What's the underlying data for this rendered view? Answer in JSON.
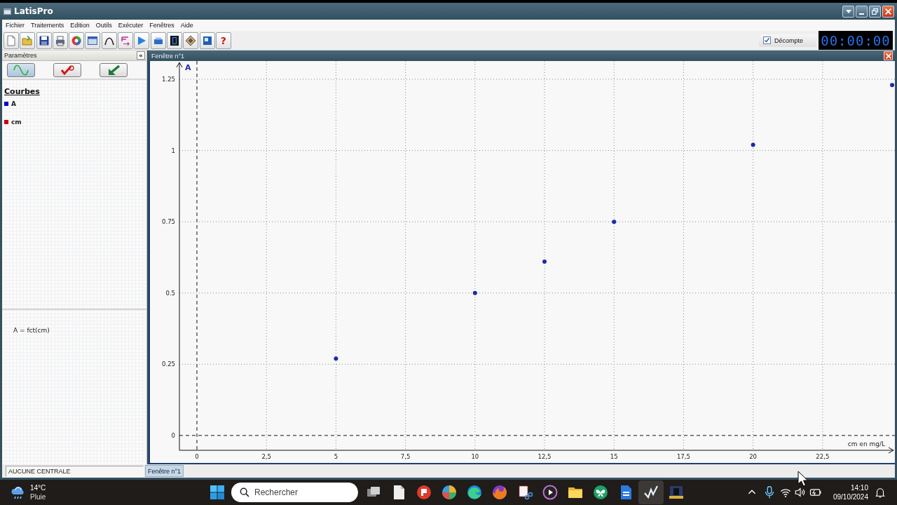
{
  "window": {
    "title": "LatisPro"
  },
  "menu": [
    "Fichier",
    "Traitements",
    "Edition",
    "Outils",
    "Exécuter",
    "Fenêtres",
    "Aide"
  ],
  "toolbar": {
    "help_label": "?",
    "countdown": {
      "label": "Décompte",
      "checked": true
    },
    "timer": "00:00:00"
  },
  "parameters_panel": {
    "title": "Paramètres",
    "collapse_label": "«",
    "mode_buttons": [
      {
        "selected": true
      },
      {
        "selected": false
      },
      {
        "selected": false
      }
    ],
    "curves_heading": "Courbes",
    "curves": [
      {
        "name": "A",
        "color": "#0000cc"
      },
      {
        "name": "cm",
        "color": "#cc0000"
      }
    ],
    "formula": "A = fct(cm)"
  },
  "chart_window": {
    "title": "Fenêtre n°1",
    "chart_data": {
      "type": "scatter",
      "xlabel": "cm en mg/L",
      "x": [
        5,
        10,
        12.5,
        15,
        20,
        25
      ],
      "series": [
        {
          "name": "A",
          "color": "#1a2aa8",
          "values": [
            0.27,
            0.5,
            0.61,
            0.75,
            1.02,
            1.23
          ]
        }
      ],
      "xlim": [
        -0.63,
        25.1
      ],
      "ylim": [
        -0.052,
        1.314
      ],
      "grid": true,
      "xticks": [
        {
          "value": 0,
          "label": "0"
        },
        {
          "value": 2.5,
          "label": "2,5"
        },
        {
          "value": 5,
          "label": "5"
        },
        {
          "value": 7.5,
          "label": "7,5"
        },
        {
          "value": 10,
          "label": "10"
        },
        {
          "value": 12.5,
          "label": "12,5"
        },
        {
          "value": 15,
          "label": "15"
        },
        {
          "value": 17.5,
          "label": "17,5"
        },
        {
          "value": 20,
          "label": "20"
        },
        {
          "value": 22.5,
          "label": "22,5"
        }
      ],
      "yticks": [
        {
          "value": 0,
          "label": "0"
        },
        {
          "value": 0.25,
          "label": "0.25"
        },
        {
          "value": 0.5,
          "label": "0.5"
        },
        {
          "value": 0.75,
          "label": "0.75"
        },
        {
          "value": 1,
          "label": "1"
        },
        {
          "value": 1.25,
          "label": "1.25"
        }
      ]
    }
  },
  "status_bar": {
    "acquisition": "AUCUNE CENTRALE",
    "window_tabs": [
      {
        "label": "Fenêtre n°1",
        "selected": true
      }
    ]
  },
  "taskbar": {
    "weather": {
      "temperature": "14°C",
      "condition": "Pluie"
    },
    "search": {
      "placeholder": "Rechercher"
    },
    "apps": [
      {
        "active": false
      },
      {
        "active": false
      },
      {
        "active": false
      },
      {
        "active": false
      },
      {
        "active": false
      },
      {
        "active": false
      },
      {
        "active": false
      },
      {
        "active": false
      },
      {
        "active": false
      },
      {
        "active": false
      },
      {
        "active": false
      },
      {
        "active": true
      },
      {
        "active": false
      }
    ],
    "clock": {
      "time": "14:10",
      "date": "09/10/2024"
    }
  }
}
